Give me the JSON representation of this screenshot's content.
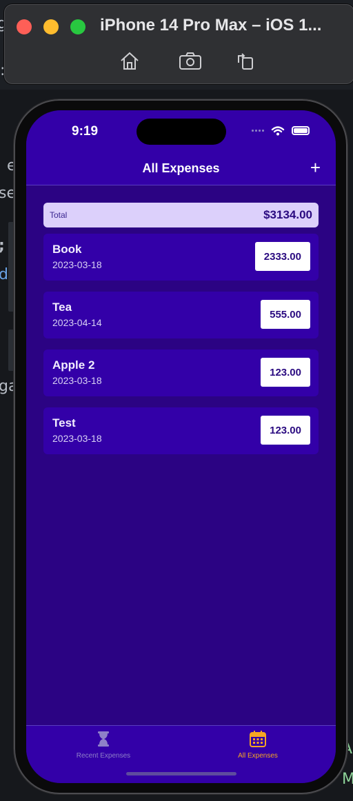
{
  "simulator": {
    "title": "iPhone 14 Pro Max – iOS 1...",
    "toolbar": [
      "home-icon",
      "screenshot-icon",
      "rotate-icon"
    ]
  },
  "status_bar": {
    "time": "9:19"
  },
  "nav": {
    "title": "All Expenses",
    "add_label": "+"
  },
  "total": {
    "label": "Total",
    "amount": "$3134.00"
  },
  "expenses": [
    {
      "name": "Book",
      "date": "2023-03-18",
      "amount": "2333.00"
    },
    {
      "name": "Tea",
      "date": "2023-04-14",
      "amount": "555.00"
    },
    {
      "name": "Apple 2",
      "date": "2023-03-18",
      "amount": "123.00"
    },
    {
      "name": "Test",
      "date": "2023-03-18",
      "amount": "123.00"
    }
  ],
  "tabs": [
    {
      "label": "Recent Expenses",
      "icon": "hourglass-icon",
      "active": false
    },
    {
      "label": "All Expenses",
      "icon": "calendar-icon",
      "active": true
    }
  ],
  "colors": {
    "accent": "#f5a623",
    "primary": "#3300a8",
    "background": "#2b0383",
    "total_card": "#dcd0fb"
  }
}
